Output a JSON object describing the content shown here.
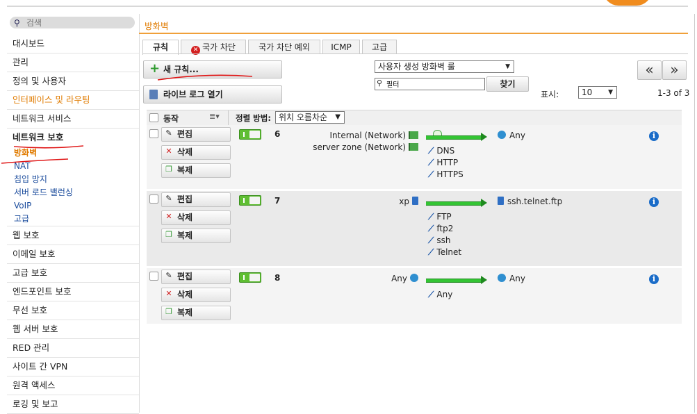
{
  "sidebar": {
    "search_placeholder": "검색",
    "menu_top": [
      "대시보드",
      "관리",
      "정의 및 사용자",
      "인터페이스 및 라우팅",
      "네트워크 서비스"
    ],
    "group": "네트워크 보호",
    "sub": [
      "방화벽",
      "NAT",
      "침입 방지",
      "서버 로드 밸런싱",
      "VoIP",
      "고급"
    ],
    "menu_bottom": [
      "웹 보호",
      "이메일 보호",
      "고급 보호",
      "엔드포인트 보호",
      "무선 보호",
      "웹 서버 보호",
      "RED 관리",
      "사이트 간 VPN",
      "원격 액세스",
      "로깅 및 보고"
    ]
  },
  "header": {
    "title": "방화벽"
  },
  "tabs": [
    "규칙",
    "국가 차단",
    "국가 차단 예외",
    "ICMP",
    "고급"
  ],
  "toolbar": {
    "new_rule": "새 규칙...",
    "live_log": "라이브 로그 열기",
    "filter_select": "사용자 생성 방화벽 룰",
    "search_value": "필터",
    "find": "찾기",
    "show_label": "표시:",
    "page_size": "10",
    "count": "1-3 of 3",
    "prev": "«",
    "next": "»"
  },
  "table": {
    "action_header": "동작",
    "sort_label": "정렬 방법:",
    "sort_value": "위치 오름차순",
    "btn_edit": "편집",
    "btn_delete": "삭제",
    "btn_copy": "복제",
    "rows": [
      {
        "num": "6",
        "sources": [
          "Internal (Network)",
          "server zone (Network)"
        ],
        "services": [
          "DNS",
          "HTTP",
          "HTTPS"
        ],
        "dest": "Any"
      },
      {
        "num": "7",
        "sources": [
          "xp"
        ],
        "services": [
          "FTP",
          "ftp2",
          "ssh",
          "Telnet"
        ],
        "dest": "ssh.telnet.ftp"
      },
      {
        "num": "8",
        "sources": [
          "Any"
        ],
        "services": [
          "Any"
        ],
        "dest": "Any"
      }
    ]
  },
  "colors": {
    "accent": "#e07b00",
    "toggle_on": "#5fbe32",
    "arrow": "#33c433"
  }
}
